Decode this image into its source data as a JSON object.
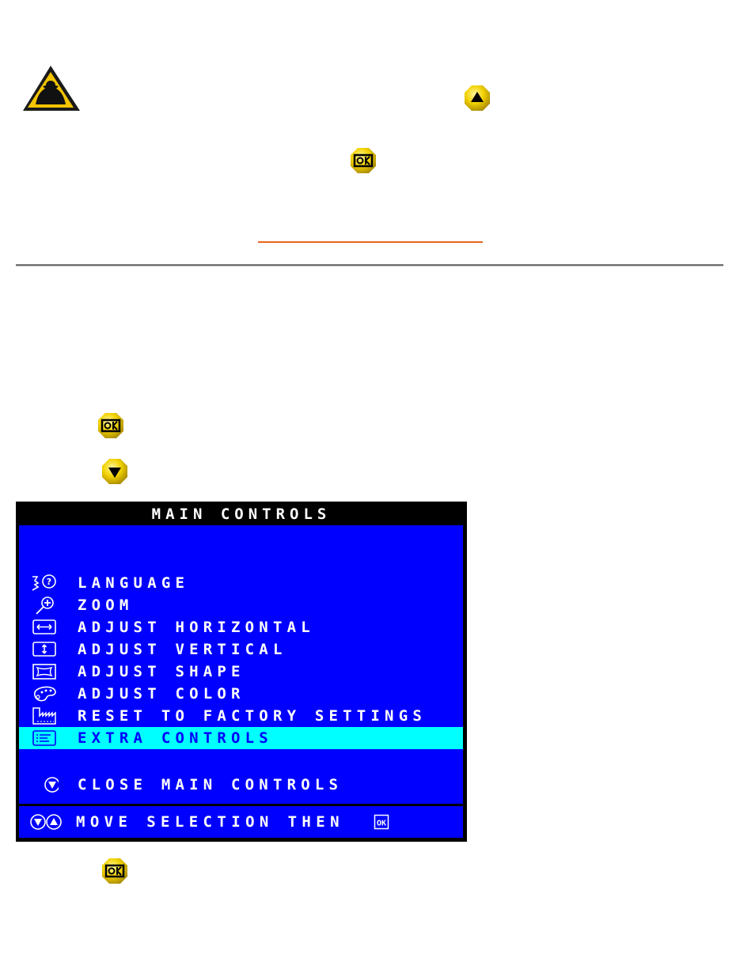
{
  "page": {
    "icons": {
      "warning": "warning-triangle-icon",
      "up_button": "up-arrow-button-icon",
      "ok_button": "ok-button-icon",
      "down_button": "down-arrow-button-icon"
    },
    "colors": {
      "link_underline": "#e8641e",
      "icon_yellow": "#f2d200",
      "osd_blue": "#0000ff",
      "osd_highlight": "#00ffff",
      "osd_frame": "#000000"
    }
  },
  "osd": {
    "title": "MAIN CONTROLS",
    "items": [
      {
        "label": "LANGUAGE",
        "icon": "language-icon",
        "selected": false
      },
      {
        "label": "ZOOM",
        "icon": "zoom-icon",
        "selected": false
      },
      {
        "label": "ADJUST HORIZONTAL",
        "icon": "horizontal-adjust-icon",
        "selected": false
      },
      {
        "label": "ADJUST VERTICAL",
        "icon": "vertical-adjust-icon",
        "selected": false
      },
      {
        "label": "ADJUST SHAPE",
        "icon": "shape-icon",
        "selected": false
      },
      {
        "label": "ADJUST COLOR",
        "icon": "color-palette-icon",
        "selected": false
      },
      {
        "label": "RESET TO FACTORY SETTINGS",
        "icon": "factory-icon",
        "selected": false
      },
      {
        "label": "EXTRA CONTROLS",
        "icon": "extra-controls-icon",
        "selected": true
      }
    ],
    "close_label": "CLOSE MAIN CONTROLS",
    "footer": "MOVE SELECTION THEN",
    "footer_ok": "OK"
  }
}
